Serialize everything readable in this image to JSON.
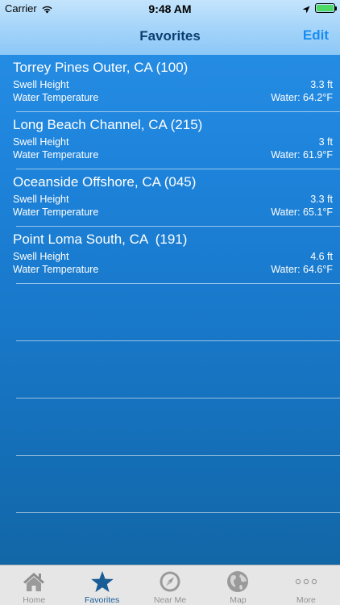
{
  "status_bar": {
    "carrier": "Carrier",
    "time": "9:48 AM"
  },
  "nav": {
    "title": "Favorites",
    "edit_label": "Edit"
  },
  "favorites": [
    {
      "title": "Torrey Pines Outer, CA (100)",
      "swell_label": "Swell Height",
      "swell_value": "3.3 ft",
      "water_label": "Water Temperature",
      "water_value": "Water: 64.2°F"
    },
    {
      "title": "Long Beach Channel, CA (215)",
      "swell_label": "Swell Height",
      "swell_value": "3 ft",
      "water_label": "Water Temperature",
      "water_value": "Water: 61.9°F"
    },
    {
      "title": "Oceanside Offshore, CA (045)",
      "swell_label": "Swell Height",
      "swell_value": "3.3 ft",
      "water_label": "Water Temperature",
      "water_value": "Water: 65.1°F"
    },
    {
      "title": "Point Loma South, CA  (191)",
      "swell_label": "Swell Height",
      "swell_value": "4.6 ft",
      "water_label": "Water Temperature",
      "water_value": "Water: 64.6°F"
    }
  ],
  "tabs": [
    {
      "label": "Home",
      "icon": "house-icon",
      "active": false
    },
    {
      "label": "Favorites",
      "icon": "star-icon",
      "active": true
    },
    {
      "label": "Near Me",
      "icon": "compass-icon",
      "active": false
    },
    {
      "label": "Map",
      "icon": "globe-icon",
      "active": false
    },
    {
      "label": "More",
      "icon": "more-dots-icon",
      "active": false
    }
  ],
  "colors": {
    "accent": "#1a8cf0",
    "nav_title": "#0d3f72",
    "active_tab": "#1a5c96",
    "inactive_tab": "#929292",
    "battery": "#4cd964"
  }
}
